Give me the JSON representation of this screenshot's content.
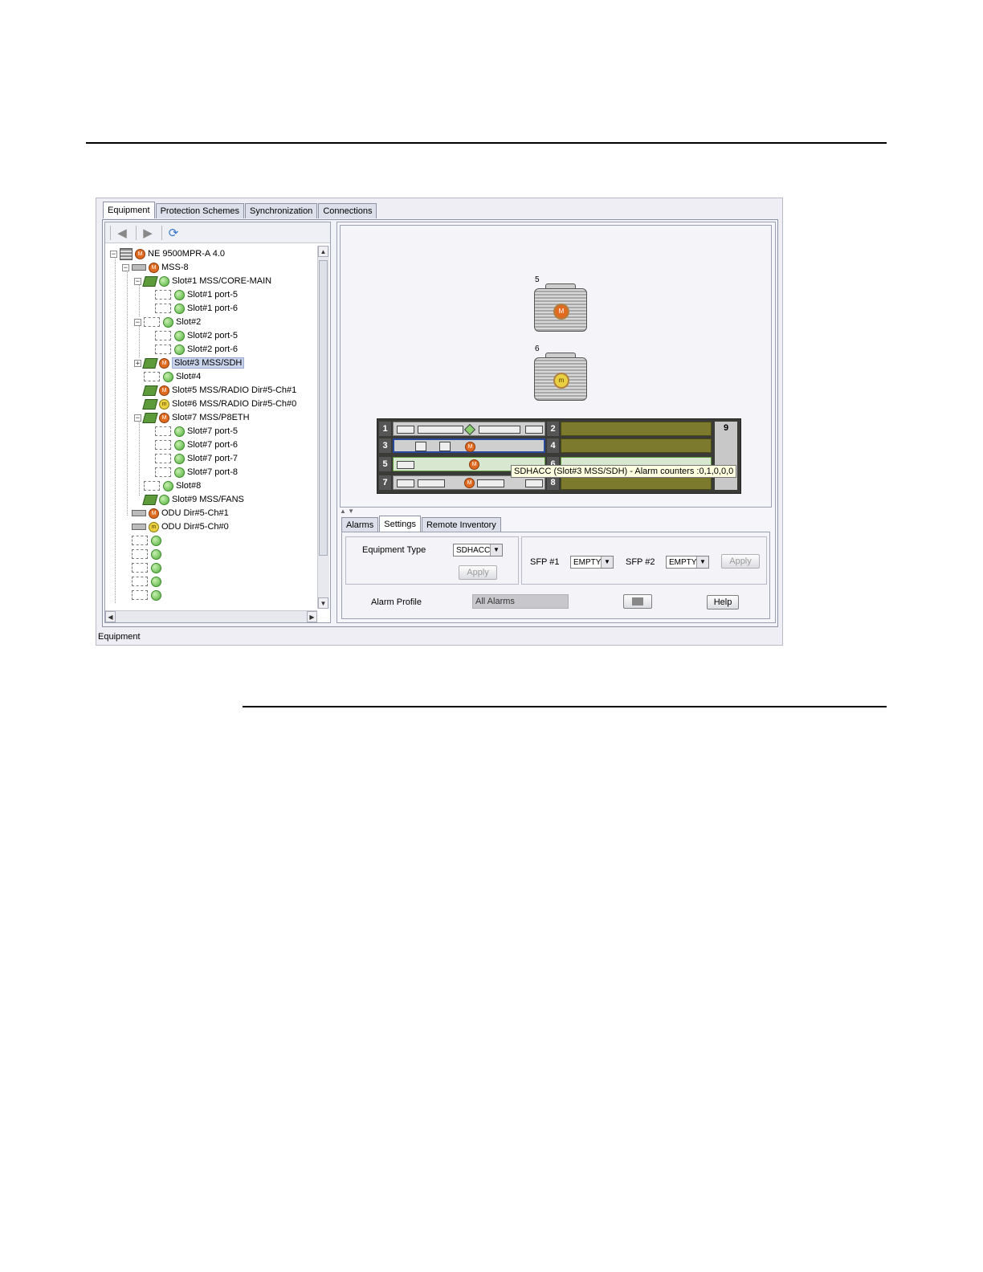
{
  "main_tabs": [
    "Equipment",
    "Protection Schemes",
    "Synchronization",
    "Connections"
  ],
  "toolbar": {
    "back_icon": "back-arrow-icon",
    "forward_icon": "forward-arrow-icon",
    "refresh_icon": "refresh-icon"
  },
  "tree": {
    "root": "NE 9500MPR-A 4.0",
    "mss": "MSS-8",
    "slot1": "Slot#1 MSS/CORE-MAIN",
    "slot1_port5": "Slot#1  port-5",
    "slot1_port6": "Slot#1  port-6",
    "slot2": "Slot#2",
    "slot2_port5": "Slot#2  port-5",
    "slot2_port6": "Slot#2  port-6",
    "slot3": "Slot#3 MSS/SDH",
    "slot4": "Slot#4",
    "slot5": "Slot#5 MSS/RADIO Dir#5-Ch#1",
    "slot6": "Slot#6 MSS/RADIO Dir#5-Ch#0",
    "slot7": "Slot#7 MSS/P8ETH",
    "slot7_port5": "Slot#7  port-5",
    "slot7_port6": "Slot#7  port-6",
    "slot7_port7": "Slot#7  port-7",
    "slot7_port8": "Slot#7  port-8",
    "slot8": "Slot#8",
    "slot9": "Slot#9 MSS/FANS",
    "odu1": "ODU Dir#5-Ch#1",
    "odu0": "ODU Dir#5-Ch#0"
  },
  "shelf_view": {
    "odu_top_label": "5",
    "odu_bottom_label": "6",
    "badge_major": "M",
    "badge_minor": "m",
    "slot_numbers": [
      "1",
      "2",
      "3",
      "4",
      "5",
      "6",
      "7",
      "8",
      "9"
    ],
    "tooltip": "SDHACC (Slot#3 MSS/SDH) - Alarm counters :0,1,0,0,0",
    "colors": {
      "card_olive": "#7c7a2c",
      "major_alarm": "#e06a20",
      "minor_alarm": "#e8d040",
      "ok_green": "#4fae3a"
    }
  },
  "sub_tabs": [
    "Alarms",
    "Settings",
    "Remote Inventory"
  ],
  "settings": {
    "equipment_type_label": "Equipment Type",
    "equipment_type_value": "SDHACC",
    "apply_label": "Apply",
    "sfp1_label": "SFP #1",
    "sfp1_value": "EMPTY",
    "sfp2_label": "SFP #2",
    "sfp2_value": "EMPTY",
    "sfp_apply_label": "Apply",
    "alarm_profile_label": "Alarm Profile",
    "alarm_profile_value": "All Alarms",
    "help_label": "Help"
  },
  "status_bar": "Equipment"
}
